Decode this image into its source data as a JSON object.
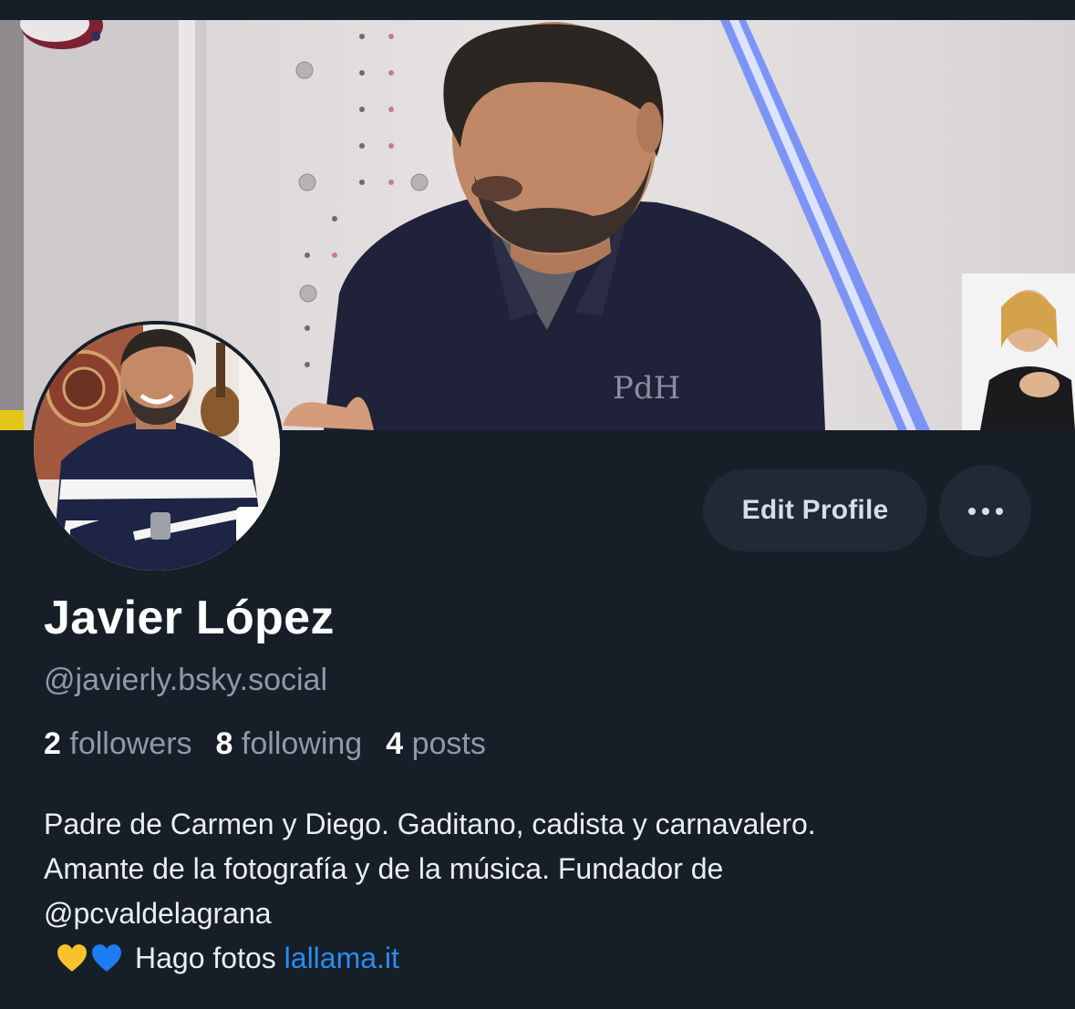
{
  "profile": {
    "name": "Javier López",
    "handle": "@javierly.bsky.social",
    "stats": {
      "followers_count": "2",
      "followers_label": "followers",
      "following_count": "8",
      "following_label": "following",
      "posts_count": "4",
      "posts_label": "posts"
    },
    "bio": {
      "line1": "Padre de Carmen y Diego. Gaditano, cadista y carnavalero.",
      "line2": "Amante de la fotografía y de la música. Fundador de",
      "line3": "@pcvaldelagrana",
      "line4_text": "Hago fotos",
      "line4_link": "lallama.it"
    }
  },
  "actions": {
    "edit_profile_label": "Edit Profile",
    "more_icon": "ellipsis-icon"
  },
  "banner": {
    "shirt_logo": "PdH"
  },
  "colors": {
    "background": "#161e27",
    "button_bg": "#1f2a36",
    "link": "#2a8cf6",
    "muted_text": "#8d9aaa",
    "heart_yellow": "#f7c22b",
    "heart_blue": "#1e7cf2"
  }
}
